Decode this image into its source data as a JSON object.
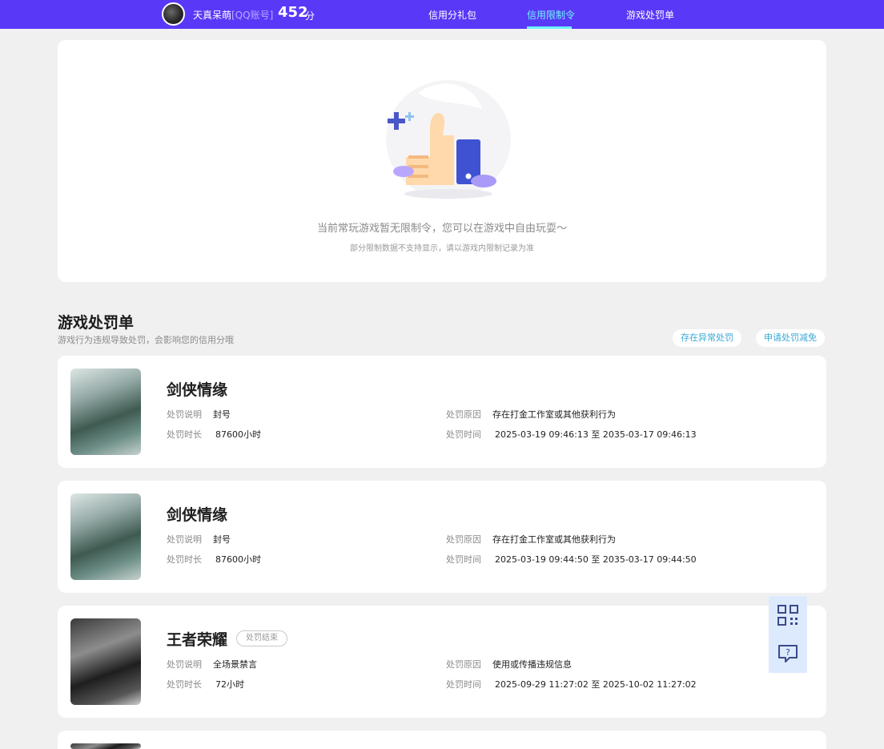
{
  "header": {
    "username": "天真呆萌",
    "account_type": "[QQ账号]",
    "score": "452",
    "score_unit": "分",
    "nav": [
      {
        "label": "信用分礼包",
        "active": false
      },
      {
        "label": "信用限制令",
        "active": true
      },
      {
        "label": "游戏处罚单",
        "active": false
      }
    ],
    "accent": "#5a38f7",
    "active_color": "#6ff3ff"
  },
  "restriction": {
    "message": "当前常玩游戏暂无限制令，您可以在游戏中自由玩耍～",
    "note": "部分限制数据不支持显示，请以游戏内限制记录为准",
    "icon": "thumbs-up-illustration"
  },
  "penalties": {
    "title": "游戏处罚单",
    "subtitle": "游戏行为违规导致处罚，会影响您的信用分哦",
    "buttons": {
      "abnormal": "存在异常处罚",
      "appeal": "申请处罚减免"
    },
    "labels": {
      "desc": "处罚说明",
      "duration": "处罚时长",
      "reason": "处罚原因",
      "time": "处罚时间"
    },
    "items": [
      {
        "game": "剑侠情缘",
        "status": "",
        "desc": "封号",
        "duration": "87600小时",
        "reason": "存在打金工作室或其他获利行为",
        "time": "2025-03-19 09:46:13 至 2035-03-17 09:46:13"
      },
      {
        "game": "剑侠情缘",
        "status": "",
        "desc": "封号",
        "duration": "87600小时",
        "reason": "存在打金工作室或其他获利行为",
        "time": "2025-03-19 09:44:50 至 2035-03-17 09:44:50"
      },
      {
        "game": "王者荣耀",
        "status": "处罚结束",
        "desc": "全场景禁言",
        "duration": "72小时",
        "reason": "使用或传播违规信息",
        "time": "2025-09-29 11:27:02 至 2025-10-02 11:27:02"
      }
    ]
  },
  "side_buttons": [
    {
      "icon": "qr-code-icon"
    },
    {
      "icon": "help-chat-icon"
    }
  ]
}
